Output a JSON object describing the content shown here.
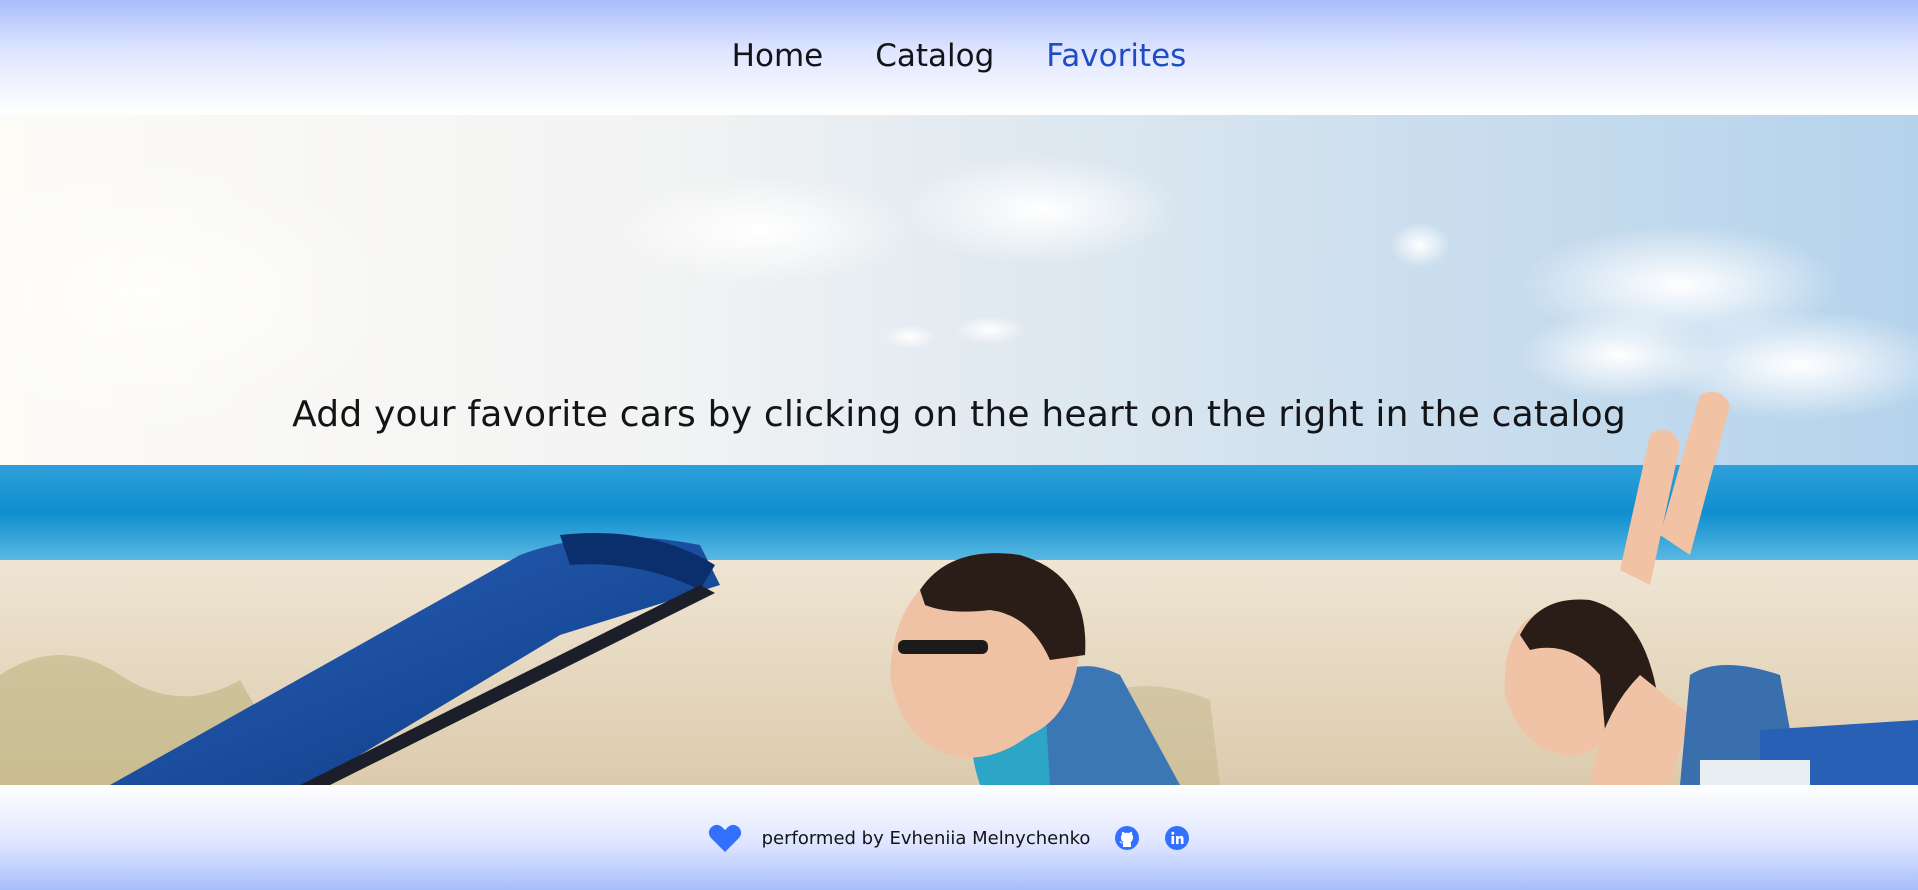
{
  "nav": {
    "items": [
      {
        "label": "Home",
        "active": false
      },
      {
        "label": "Catalog",
        "active": false
      },
      {
        "label": "Favorites",
        "active": true
      }
    ],
    "active_color": "#1f4cc4"
  },
  "hero": {
    "message": "Add your favorite cars by clicking on the heart on the right in the catalog",
    "image": "couple-in-blue-convertible-on-beach"
  },
  "footer": {
    "credit": "performed by Evheniia Melnychenko",
    "heart_icon": "heart-icon",
    "heart_color": "#3470ff",
    "social": [
      {
        "name": "github-icon",
        "color": "#3470ff"
      },
      {
        "name": "linkedin-icon",
        "color": "#3470ff"
      }
    ]
  }
}
